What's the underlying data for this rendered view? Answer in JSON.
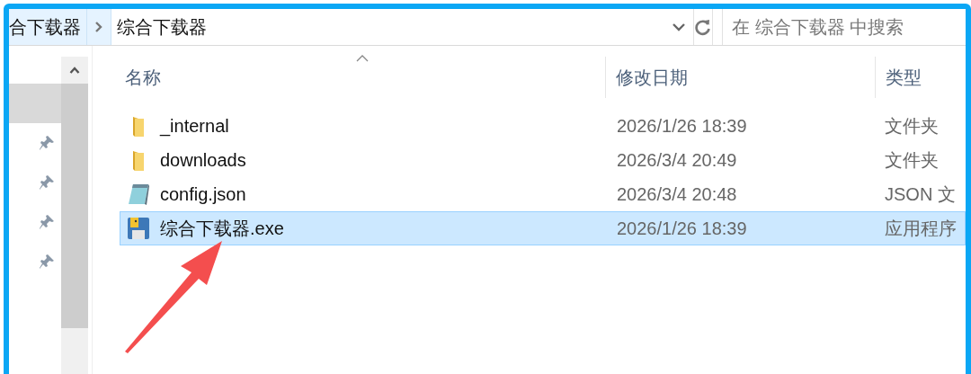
{
  "address_bar": {
    "breadcrumbs": [
      {
        "label": "合下载器",
        "selected": false
      },
      {
        "label": "综合下载器",
        "selected": true
      }
    ]
  },
  "search": {
    "placeholder": "在 综合下载器 中搜索"
  },
  "navigation": {
    "items": [
      {
        "selected": true,
        "pinned": false
      },
      {
        "selected": false,
        "pinned": true
      },
      {
        "selected": false,
        "pinned": true
      },
      {
        "selected": false,
        "pinned": true
      },
      {
        "selected": false,
        "pinned": true
      }
    ]
  },
  "file_list": {
    "columns": [
      {
        "label": "名称",
        "sorted": true
      },
      {
        "label": "修改日期",
        "sorted": false
      },
      {
        "label": "类型",
        "sorted": false
      }
    ],
    "rows": [
      {
        "kind": "folder",
        "name": "_internal",
        "modified": "2026/1/26 18:39",
        "type": "文件夹",
        "selected": false
      },
      {
        "kind": "folder",
        "name": "downloads",
        "modified": "2026/3/4 20:49",
        "type": "文件夹",
        "selected": false
      },
      {
        "kind": "json",
        "name": "config.json",
        "modified": "2026/3/4 20:48",
        "type": "JSON 文",
        "selected": false
      },
      {
        "kind": "exe",
        "name": "综合下载器.exe",
        "modified": "2026/1/26 18:39",
        "type": "应用程序",
        "selected": true
      }
    ]
  }
}
